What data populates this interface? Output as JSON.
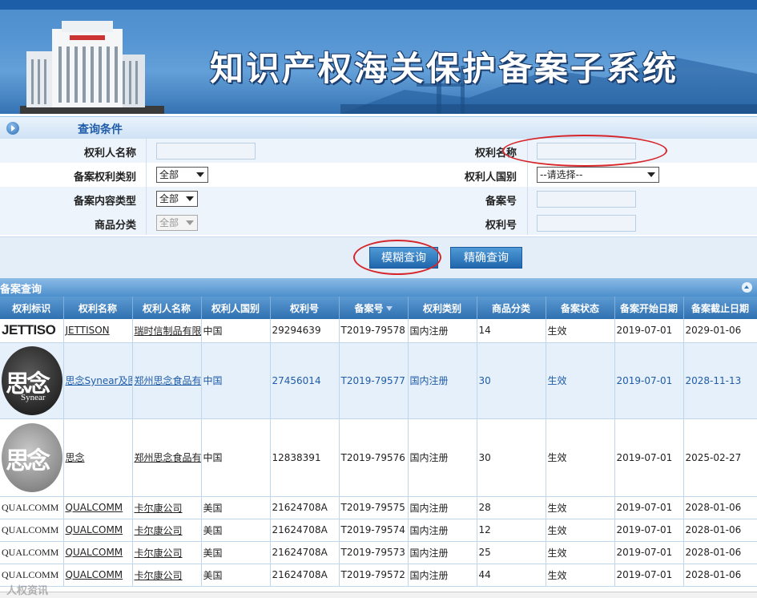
{
  "banner": {
    "title": "知识产权海关保护备案子系统"
  },
  "query": {
    "header_title": "查询条件",
    "rows": [
      {
        "label_left": "权利人名称",
        "label_right": "权利名称"
      },
      {
        "label_left": "备案权利类别",
        "select_left": "全部",
        "label_right": "权利人国别",
        "select_right": "--请选择--"
      },
      {
        "label_left": "备案内容类型",
        "select_left": "全部",
        "label_right": "备案号"
      },
      {
        "label_left": "商品分类",
        "select_left": "全部",
        "label_right": "权利号"
      }
    ],
    "buttons": {
      "fuzzy": "模糊查询",
      "exact": "精确查询"
    }
  },
  "results": {
    "header_title": "备案查询",
    "columns": [
      "权利标识",
      "权利名称",
      "权利人名称",
      "权利人国别",
      "权利号",
      "备案号",
      "权利类别",
      "商品分类",
      "备案状态",
      "备案开始日期",
      "备案截止日期"
    ],
    "rows": [
      {
        "logo": "JETTISO",
        "name": "JETTISON",
        "owner": "瑞时信制品有限",
        "country": "中国",
        "right_no": "29294639",
        "record_no": "T2019-79578",
        "type": "国内注册",
        "class": "14",
        "status": "生效",
        "start": "2019-07-01",
        "end": "2029-01-06"
      },
      {
        "logo_cn": "思念",
        "logo_en": "Synear",
        "name": "思念Synear及图",
        "owner": "郑州思念食品有",
        "country": "中国",
        "right_no": "27456014",
        "record_no": "T2019-79577",
        "type": "国内注册",
        "class": "30",
        "status": "生效",
        "start": "2019-07-01",
        "end": "2028-11-13"
      },
      {
        "logo_cn": "思念",
        "name": "思念",
        "owner": "郑州思念食品有",
        "country": "中国",
        "right_no": "12838391",
        "record_no": "T2019-79576",
        "type": "国内注册",
        "class": "30",
        "status": "生效",
        "start": "2019-07-01",
        "end": "2025-02-27"
      },
      {
        "logo": "QUALCOMM",
        "name": "QUALCOMM",
        "owner": "卡尔康公司",
        "country": "美国",
        "right_no": "21624708A",
        "record_no": "T2019-79575",
        "type": "国内注册",
        "class": "28",
        "status": "生效",
        "start": "2019-07-01",
        "end": "2028-01-06"
      },
      {
        "logo": "QUALCOMM",
        "name": "QUALCOMM",
        "owner": "卡尔康公司",
        "country": "美国",
        "right_no": "21624708A",
        "record_no": "T2019-79574",
        "type": "国内注册",
        "class": "12",
        "status": "生效",
        "start": "2019-07-01",
        "end": "2028-01-06"
      },
      {
        "logo": "QUALCOMM",
        "name": "QUALCOMM",
        "owner": "卡尔康公司",
        "country": "美国",
        "right_no": "21624708A",
        "record_no": "T2019-79573",
        "type": "国内注册",
        "class": "25",
        "status": "生效",
        "start": "2019-07-01",
        "end": "2028-01-06"
      },
      {
        "logo": "QUALCOMM",
        "name": "QUALCOMM",
        "owner": "卡尔康公司",
        "country": "美国",
        "right_no": "21624708A",
        "record_no": "T2019-79572",
        "type": "国内注册",
        "class": "44",
        "status": "生效",
        "start": "2019-07-01",
        "end": "2028-01-06"
      }
    ]
  },
  "watermark": "人权资讯",
  "colors": {
    "accent": "#2f70b0",
    "annotation_ring": "#d6262b"
  }
}
